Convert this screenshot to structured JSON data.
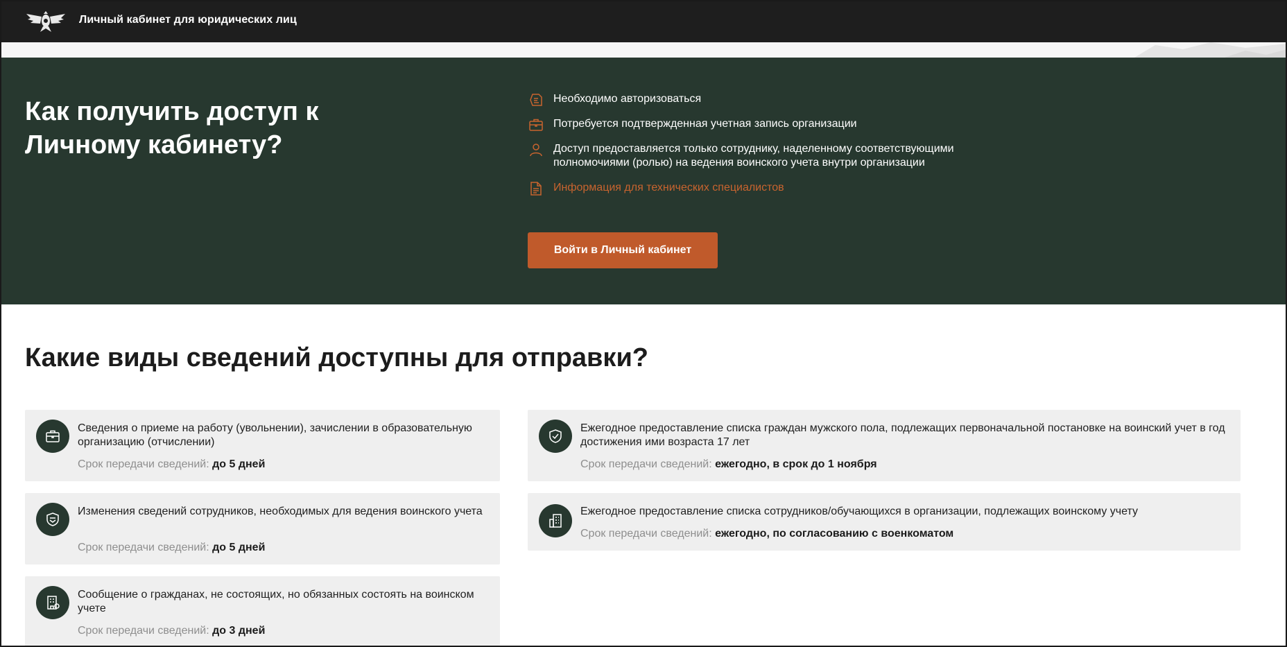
{
  "header": {
    "title": "Личный кабинет для юридических лиц",
    "logo_icon": "emblem-eagle-icon"
  },
  "hero": {
    "title": "Как получить доступ к Личному кабинету?",
    "requirements": [
      {
        "icon": "authorization-icon",
        "text": "Необходимо авторизоваться"
      },
      {
        "icon": "briefcase-icon",
        "text": "Потребуется подтвержденная учетная запись организации"
      },
      {
        "icon": "person-icon",
        "text": "Доступ предоставляется только сотруднику, наделенному соответствующими полномочиями (ролью) на ведения воинского учета внутри организации"
      }
    ],
    "tech_link": {
      "icon": "document-icon",
      "text": "Информация для технических специалистов"
    },
    "login_button": "Войти в Личный кабинет"
  },
  "types": {
    "title": "Какие виды сведений доступны для отправки?",
    "term_label": "Срок передачи сведений:",
    "cards": [
      {
        "icon": "briefcase-icon",
        "text": "Сведения о приеме на работу (увольнении), зачислении в образовательную организацию (отчислении)",
        "term": "до 5 дней"
      },
      {
        "icon": "shield-edit-icon",
        "text": "Изменения сведений сотрудников, необходимых для ведения воинского учета",
        "term": "до 5 дней"
      },
      {
        "icon": "building-document-icon",
        "text": "Сообщение о гражданах, не состоящих, но обязанных состоять на воинском учете",
        "term": "до 3 дней"
      },
      {
        "icon": "shield-check-icon",
        "text": "Ежегодное предоставление списка граждан мужского пола, подлежащих первоначальной постановке на воинский учет в год достижения ими возраста 17 лет",
        "term": "ежегодно, в срок до 1 ноября"
      },
      {
        "icon": "office-building-icon",
        "text": "Ежегодное предоставление списка сотрудников/обучающихся в организации, подлежащих воинскому учету",
        "term": "ежегодно, по согласованию с военкоматом"
      }
    ]
  },
  "colors": {
    "hero_bg": "#27382f",
    "accent": "#c05a2b",
    "topbar_bg": "#1e1e1e",
    "card_bg": "#efefef"
  }
}
